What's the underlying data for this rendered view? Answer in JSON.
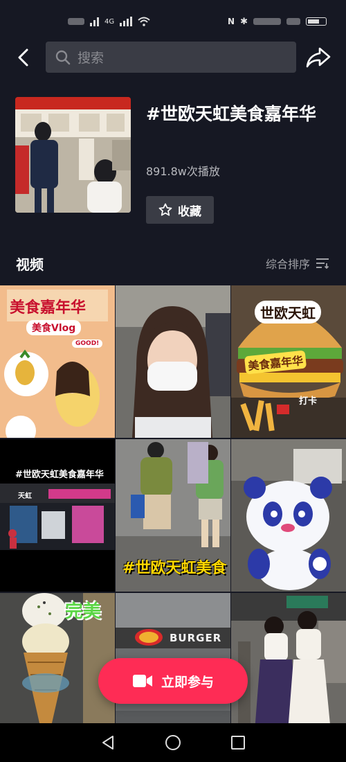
{
  "status_bar": {
    "network_label": "4G",
    "colors": {
      "text": "#e6e6e6"
    }
  },
  "search": {
    "placeholder": "搜索"
  },
  "topic": {
    "title": "#世欧天虹美食嘉年华",
    "plays": "891.8w次播放",
    "favorite_label": "收藏"
  },
  "section": {
    "title": "视频",
    "sort_label": "综合排序"
  },
  "tiles": [
    {
      "caption_main": "美食嘉年华",
      "caption_sub": "美食Vlog",
      "caption_badge": "GOOD!"
    },
    {
      "caption_main": ""
    },
    {
      "caption_main": "世欧天虹",
      "caption_sub": "美食嘉年华",
      "caption_badge": "打卡"
    },
    {
      "caption_main": "#世欧天虹美食嘉年华",
      "caption_sub": "天虹"
    },
    {
      "caption_main": "#世欧天虹美食"
    },
    {
      "caption_main": ""
    },
    {
      "caption_main": "完美"
    },
    {
      "caption_main": "BURGER"
    },
    {
      "caption_main": ""
    }
  ],
  "join_button": {
    "label": "立即参与"
  },
  "colors": {
    "background": "#161823",
    "accent": "#fe2c55",
    "search_bg": "#3a3c45",
    "muted_text": "#a1a2a7"
  },
  "icons": {
    "back": "chevron-left-icon",
    "search": "search-icon",
    "share": "share-arrow-icon",
    "favorite": "star-icon",
    "sort": "sort-icon",
    "camera": "video-camera-icon"
  }
}
